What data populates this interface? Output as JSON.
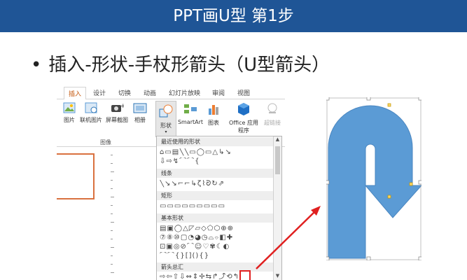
{
  "title": "PPT画U型 第1步",
  "bullet": {
    "dot": "•",
    "text": "插入-形状-手杖形箭头（U型箭头）"
  },
  "ribbon": {
    "tabs": [
      "插入",
      "设计",
      "切换",
      "动画",
      "幻灯片放映",
      "审阅",
      "视图"
    ],
    "active_tab": "插入",
    "buttons": [
      {
        "label": "图片",
        "icon": "picture-icon"
      },
      {
        "label": "联机图片",
        "icon": "online-picture-icon"
      },
      {
        "label": "屏幕截图",
        "icon": "screenshot-icon"
      },
      {
        "label": "相册",
        "icon": "album-icon"
      },
      {
        "label": "形状",
        "icon": "shapes-icon"
      },
      {
        "label": "SmartArt",
        "icon": "smartart-icon"
      },
      {
        "label": "图表",
        "icon": "chart-icon"
      },
      {
        "label": "Office 应用程序",
        "icon": "office-apps-icon"
      },
      {
        "label": "超链接",
        "icon": "hyperlink-icon"
      }
    ],
    "group_label": "图像"
  },
  "shapes_menu": {
    "recent_header": "最近使用的形状",
    "recent_row1": "⌂▭▤╲╲▭◯▭△↳↘",
    "recent_row2": "⇩⇨↯⌒⌒{",
    "lines_header": "线条",
    "lines_row": "╲↘↘⌐⌐↳ζ⌇ᘐ↻⇗",
    "rect_header": "矩形",
    "rect_row": "▭▭▭▭▭▭▭▭▭",
    "basic_header": "基本形状",
    "basic_row1": "▤▣◯△◸▱◇⬠⬡⊕⊕",
    "basic_row2": "⑦⑧⑩▢◔◕◷⌓⌔◧✚",
    "basic_row3": "⊡▣◎⊘⌒☺♡✾☾◐",
    "basic_row4": "⌒⌒{}[](){}",
    "arrow_header": "箭头总汇",
    "arrow_row": "⇨⇦⇧⇩⇔⇕✢⇆↱⤴⟲↰"
  },
  "colors": {
    "title_bg": "#1f5596",
    "u_arrow_fill": "#5b9bd5",
    "highlight": "#e02020"
  }
}
